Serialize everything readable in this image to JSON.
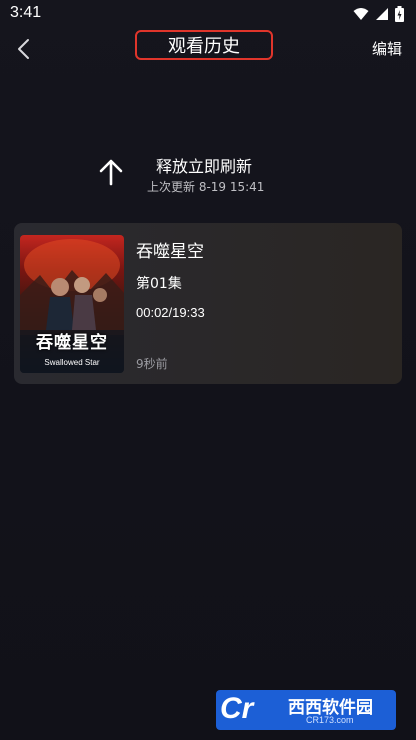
{
  "status_bar": {
    "time": "3:41"
  },
  "nav": {
    "title": "观看历史",
    "edit_label": "编辑"
  },
  "refresh": {
    "main_text": "释放立即刷新",
    "sub_text": "上次更新 8-19 15:41"
  },
  "history": [
    {
      "title": "吞噬星空",
      "episode": "第01集",
      "progress": "00:02/19:33",
      "time_ago": "9秒前",
      "poster_title": "吞噬星空",
      "poster_subtitle": "Swallowed Star"
    }
  ],
  "watermark": {
    "logo": "Cr",
    "name": "西西软件园",
    "domain": "CR173.com"
  },
  "colors": {
    "background": "#13131a",
    "title_outline": "#e0352b",
    "card": "#2a2a30",
    "watermark": "#1c5fd6"
  }
}
